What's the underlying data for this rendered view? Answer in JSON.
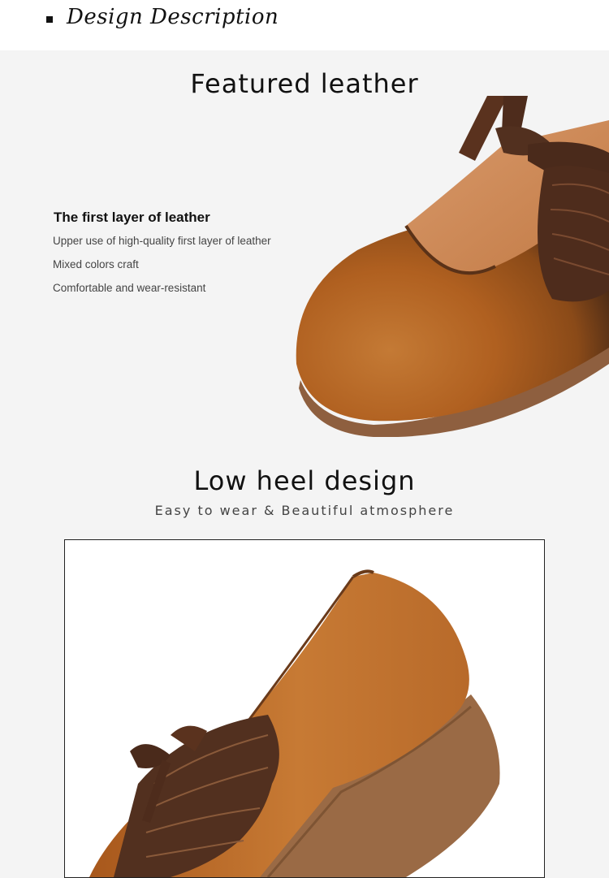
{
  "header": {
    "section_title": "Design Description"
  },
  "featured": {
    "title": "Featured leather",
    "subtitle": "The first layer of leather",
    "lines": [
      "Upper use of high-quality first layer of leather",
      "Mixed colors craft",
      "Comfortable and wear-resistant"
    ]
  },
  "heel": {
    "title": "Low heel design",
    "subtitle": "Easy to wear & Beautiful atmosphere"
  },
  "colors": {
    "leather": "#b8661e",
    "leather_dark": "#5a3520",
    "bow": "#4e2c1c",
    "sole": "#9a6a45"
  }
}
